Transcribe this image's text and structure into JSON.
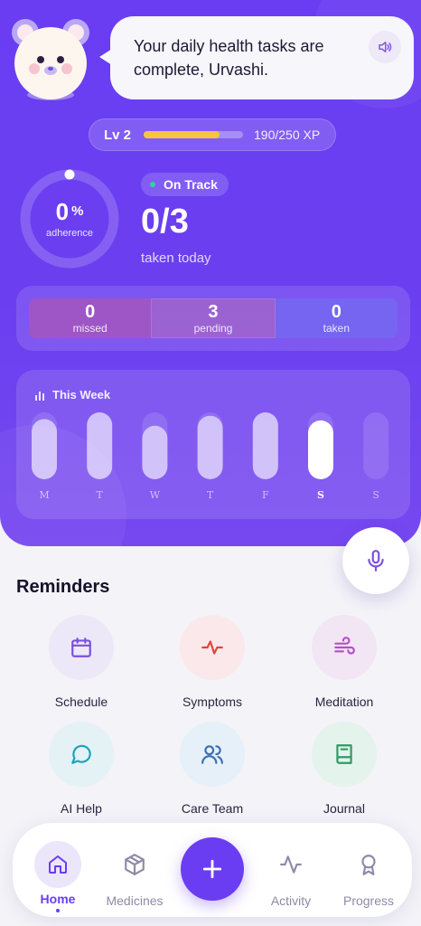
{
  "assistant": {
    "message": "Your daily health tasks are complete, Urvashi.",
    "speaker_icon": "speaker-icon"
  },
  "level": {
    "label": "Lv 2",
    "xp_text": "190/250 XP",
    "xp_progress": 0.76
  },
  "adherence": {
    "value": "0",
    "unit": "%",
    "label": "adherence",
    "fraction": 0
  },
  "today": {
    "status": "On Track",
    "count": "0/3",
    "caption": "taken today"
  },
  "stats": [
    {
      "value": "0",
      "label": "missed"
    },
    {
      "value": "3",
      "label": "pending"
    },
    {
      "value": "0",
      "label": "taken"
    }
  ],
  "week": {
    "title": "This Week",
    "days": [
      "M",
      "T",
      "W",
      "T",
      "F",
      "S",
      "S"
    ],
    "today_index": 5,
    "fill_levels": [
      0.9,
      1.0,
      0.8,
      0.95,
      1.0,
      0.88,
      0
    ]
  },
  "reminders": {
    "title": "Reminders",
    "items": [
      {
        "label": "Schedule",
        "icon": "calendar-icon",
        "bg": "#ede8f7",
        "color": "#7b4fe0"
      },
      {
        "label": "Symptoms",
        "icon": "pulse-icon",
        "bg": "#fbe8ea",
        "color": "#e0453f"
      },
      {
        "label": "Meditation",
        "icon": "wind-icon",
        "bg": "#f2e6f4",
        "color": "#b84fc9"
      },
      {
        "label": "AI Help",
        "icon": "chat-icon",
        "bg": "#e4f2f6",
        "color": "#1aa3b8"
      },
      {
        "label": "Care Team",
        "icon": "users-icon",
        "bg": "#e6f0f8",
        "color": "#3b6fb0"
      },
      {
        "label": "Journal",
        "icon": "book-icon",
        "bg": "#e4f3ec",
        "color": "#2f9a63"
      }
    ]
  },
  "nav": {
    "items": [
      {
        "label": "Home",
        "icon": "home-icon",
        "active": true
      },
      {
        "label": "Medicines",
        "icon": "box-icon"
      },
      {
        "label": "Activity",
        "icon": "activity-icon"
      },
      {
        "label": "Progress",
        "icon": "award-icon"
      }
    ],
    "fab_icon": "plus-icon"
  },
  "colors": {
    "primary": "#6a3df2",
    "xp_bar": "#f5c542",
    "on_track_dot": "#34d399"
  }
}
